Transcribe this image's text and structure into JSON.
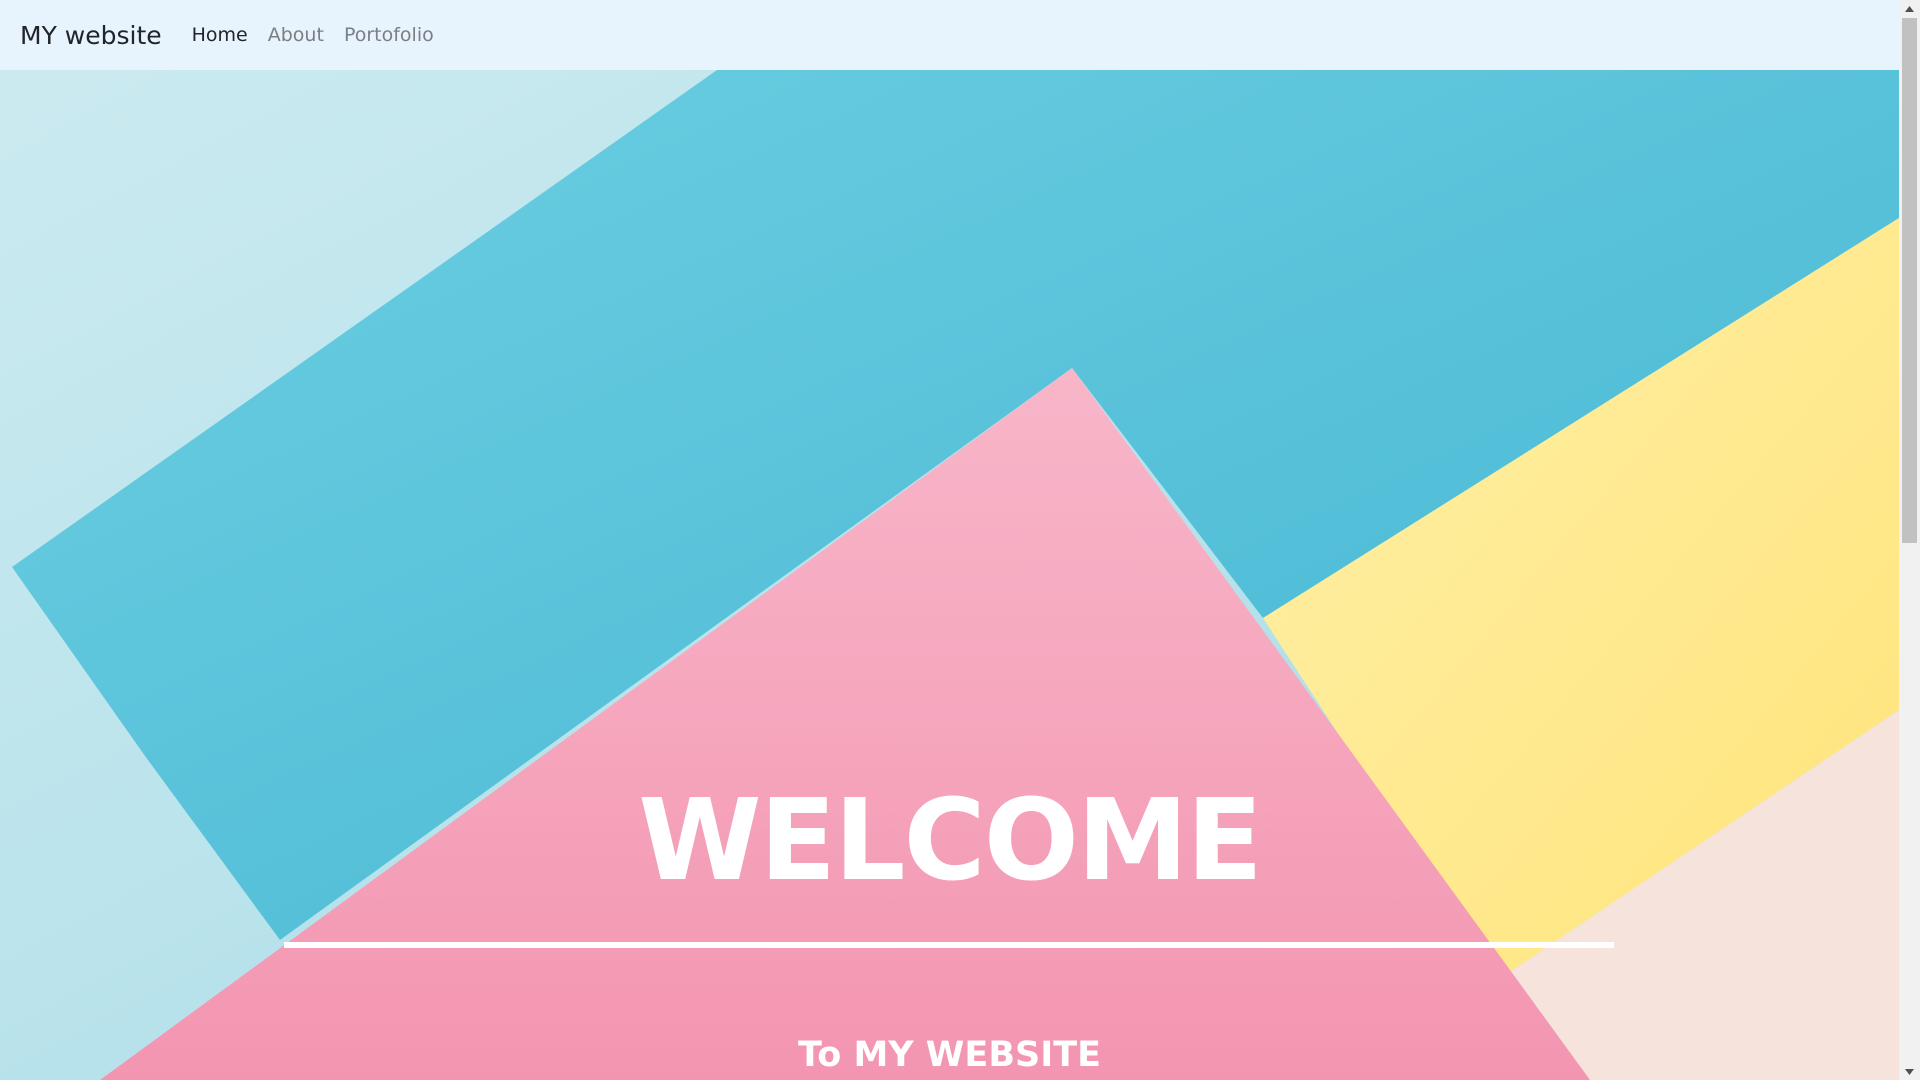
{
  "navbar": {
    "brand": "MY website",
    "links": [
      {
        "label": "Home",
        "active": true
      },
      {
        "label": "About",
        "active": false
      },
      {
        "label": "Portofolio",
        "active": false
      }
    ]
  },
  "hero": {
    "title": "WELCOME",
    "subtitle": "To MY WEBSITE"
  },
  "colors": {
    "navbar_bg": "#e7f3fd",
    "light_blue": "#bde4ec",
    "turquoise": "#5ec6dc",
    "pink": "#f5a3bd",
    "yellow": "#ffe886",
    "peach": "#f6e4dc"
  },
  "icons": {
    "scroll_up": "triangle-up-icon",
    "scroll_down": "triangle-down-icon"
  }
}
